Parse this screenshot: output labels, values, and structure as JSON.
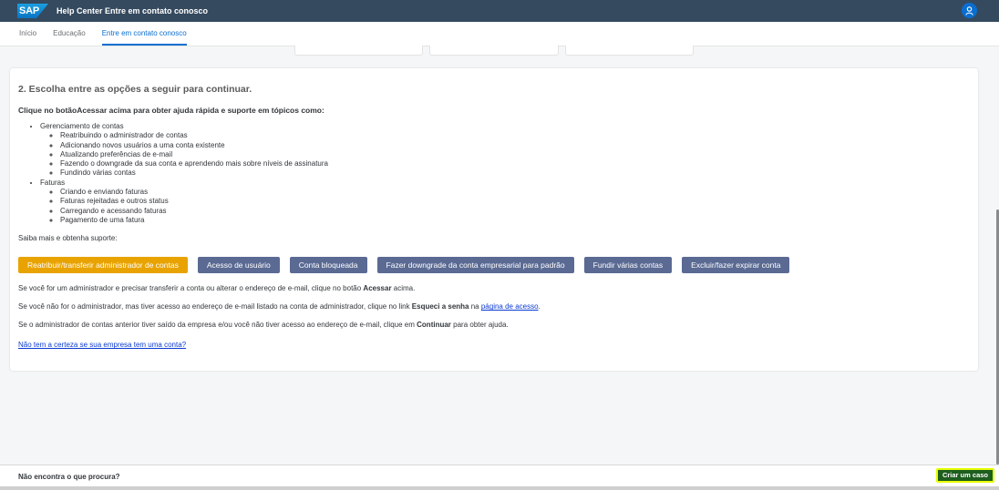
{
  "shell": {
    "logo_text": "SAP",
    "title": "Help Center Entre em contato conosco",
    "user_icon": "user-icon",
    "accent": "#354a5f"
  },
  "nav": {
    "tabs": [
      {
        "label": "Início"
      },
      {
        "label": "Educação"
      },
      {
        "label": "Entre em contato conosco"
      }
    ]
  },
  "main": {
    "heading": "2. Escolha entre as opções a seguir para continuar.",
    "lead": "Clique no botãoAcessar acima para obter ajuda rápida e suporte em tópicos como:",
    "topics": [
      {
        "label": "Gerenciamento de contas",
        "items": [
          "Reatribuindo o administrador de contas",
          "Adicionando novos usuários a uma conta existente",
          "Atualizando preferências de e-mail",
          "Fazendo o downgrade da sua conta e aprendendo mais sobre níveis de assinatura",
          "Fundindo várias contas"
        ]
      },
      {
        "label": "Faturas",
        "items": [
          "Criando e enviando faturas",
          "Faturas rejeitadas e outros status",
          "Carregando e acessando faturas",
          "Pagamento de uma fatura"
        ]
      }
    ],
    "saiba": "Saiba mais e obtenha suporte:",
    "buttons": [
      "Reatribuir/transferir administrador de contas",
      "Acesso de usuário",
      "Conta bloqueada",
      "Fazer downgrade da conta empresarial para padrão",
      "Fundir várias contas",
      "Excluir/fazer expirar conta"
    ],
    "p1": {
      "before": "Se você for um administrador e precisar transferir a conta ou alterar o endereço de e-mail, clique no botão ",
      "bold": "Acessar",
      "after": " acima."
    },
    "p2": {
      "before": "Se você não for o administrador, mas tiver acesso ao endereço de e-mail listado na conta de administrador, clique no link ",
      "bold": "Esqueci a senha",
      "mid": " na ",
      "link": "página de acesso",
      "after": "."
    },
    "p3": {
      "before": "Se o administrador de contas anterior tiver saído da empresa e/ou você não tiver acesso ao endereço de e-mail, clique em ",
      "bold": "Continuar",
      "after": " para obter ajuda."
    },
    "bottom_link": "Não tem a certeza se sua empresa tem uma conta?"
  },
  "footer": {
    "text": "Não encontra o que procura?",
    "case_button": "Criar um caso"
  }
}
